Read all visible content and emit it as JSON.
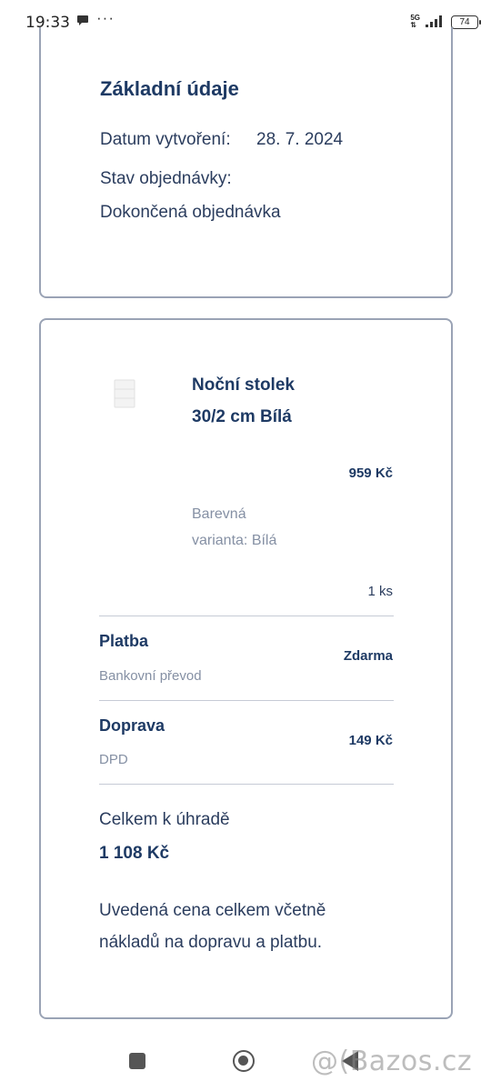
{
  "status_bar": {
    "time": "19:33",
    "more": "···",
    "network": "5G",
    "battery": "74"
  },
  "basic_info": {
    "title": "Základní údaje",
    "created_label": "Datum vytvoření:",
    "created_value": "28. 7. 2024",
    "status_label": "Stav objednávky:",
    "status_value": "Dokončená objednávka"
  },
  "order": {
    "product": {
      "name": "Noční stolek 30/2 cm Bílá",
      "price": "959 Kč",
      "variant": "Barevná varianta: Bílá",
      "quantity": "1 ks"
    },
    "payment": {
      "title": "Platba",
      "method": "Bankovní převod",
      "amount": "Zdarma"
    },
    "shipping": {
      "title": "Doprava",
      "carrier": "DPD",
      "amount": "149 Kč"
    },
    "total_label": "Celkem k úhradě",
    "total_value": "1 108 Kč",
    "note": "Uvedená cena celkem včetně nákladů na dopravu a platbu."
  },
  "watermark": "@(Bazos.cz"
}
